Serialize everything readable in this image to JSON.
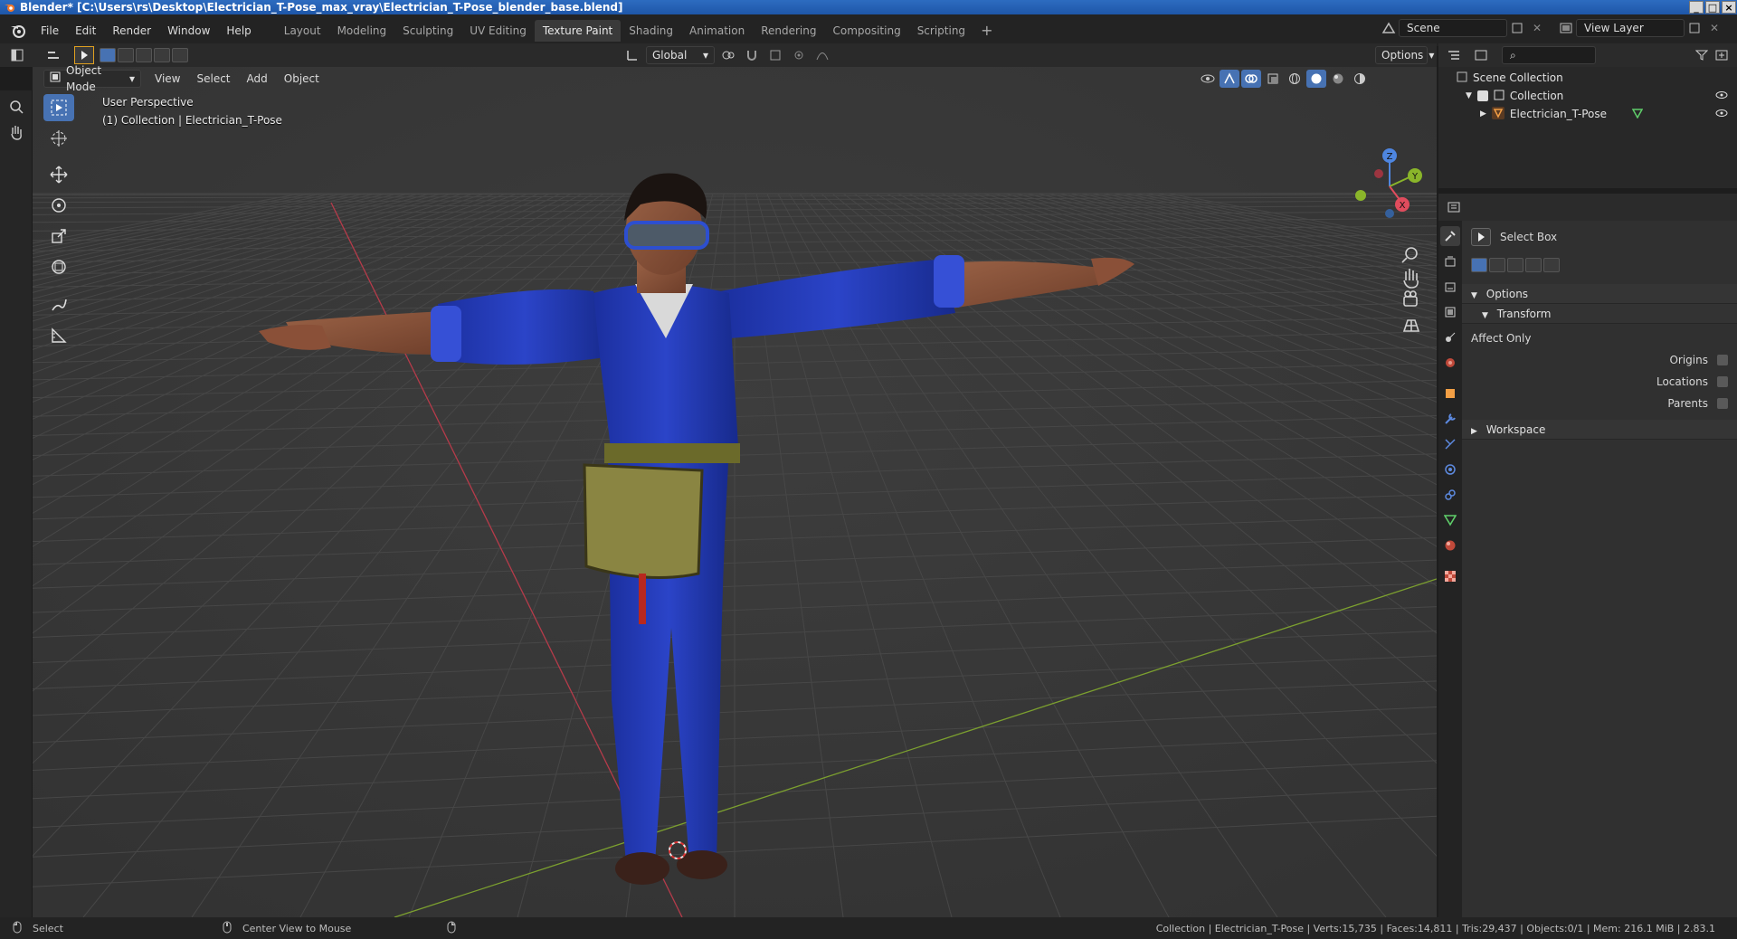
{
  "window": {
    "title": "Blender* [C:\\Users\\rs\\Desktop\\Electrician_T-Pose_max_vray\\Electrician_T-Pose_blender_base.blend]"
  },
  "menus": [
    "File",
    "Edit",
    "Render",
    "Window",
    "Help"
  ],
  "workspaces": {
    "tabs": [
      "Layout",
      "Modeling",
      "Sculpting",
      "UV Editing",
      "Texture Paint",
      "Shading",
      "Animation",
      "Rendering",
      "Compositing",
      "Scripting"
    ],
    "active": "Texture Paint",
    "add_symbol": "+"
  },
  "scene": {
    "name": "Scene",
    "view_layer": "View Layer"
  },
  "tool_header": {
    "orientation": "Global",
    "options_label": "Options"
  },
  "view_header": {
    "mode": "Object Mode",
    "menus": [
      "View",
      "Select",
      "Add",
      "Object"
    ]
  },
  "viewport": {
    "perspective": "User Perspective",
    "collection_info": "(1) Collection | Electrician_T-Pose",
    "colors": {
      "background": "#393939",
      "grid": "#444444",
      "x_axis": "#b53b4a",
      "y_axis": "#6f9a2a"
    },
    "gizmo": {
      "x": "X",
      "y": "Y",
      "z": "Z"
    }
  },
  "left_tools": [
    "select-box",
    "cursor",
    "move",
    "rotate",
    "scale",
    "transform",
    "annotate",
    "measure"
  ],
  "outliner": {
    "search_placeholder": "",
    "root": "Scene Collection",
    "collection": "Collection",
    "object": "Electrician_T-Pose"
  },
  "properties": {
    "active_tool": "Select Box",
    "options_label": "Options",
    "transform_label": "Transform",
    "affect_only_label": "Affect Only",
    "checkboxes": [
      "Origins",
      "Locations",
      "Parents"
    ],
    "workspace_label": "Workspace"
  },
  "status_bar": {
    "left_action": "Select",
    "middle_action": "Center View to Mouse",
    "stats": "Collection | Electrician_T-Pose | Verts:15,735 | Faces:14,811 | Tris:29,437 | Objects:0/1 | Mem: 216.1 MiB | 2.83.1"
  }
}
